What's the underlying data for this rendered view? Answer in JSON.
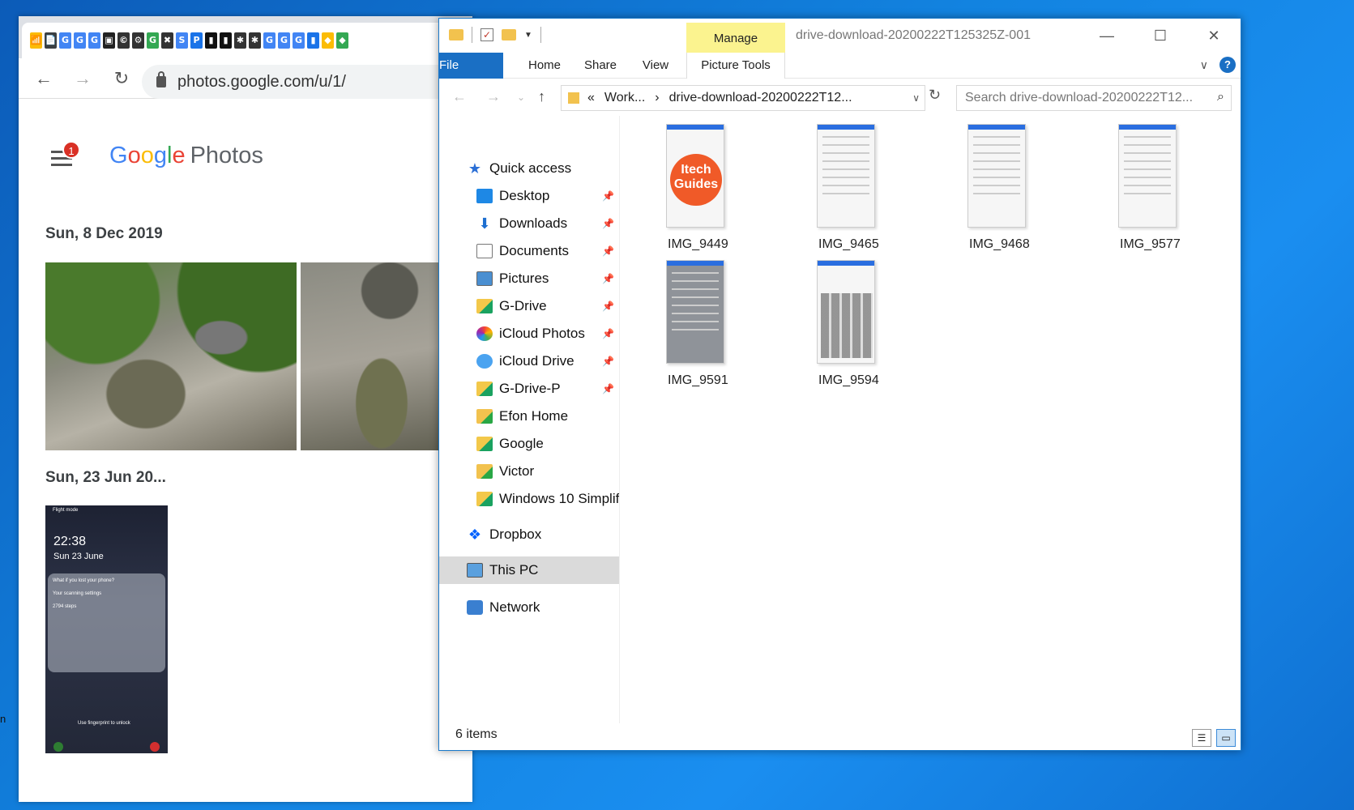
{
  "desktop": {
    "edge_text": "n"
  },
  "chrome": {
    "tab_favicons": [
      "📶",
      "📄",
      "G",
      "G",
      "G",
      "▣",
      "©",
      "⚙",
      "G",
      "✖",
      "S",
      "P",
      "▮",
      "▮",
      "✱",
      "✱",
      "G",
      "G",
      "G",
      "▮",
      "◆",
      "◆"
    ],
    "tab_close": "×",
    "nav": {
      "back": "←",
      "forward": "→",
      "reload": "↻"
    },
    "url": "photos.google.com/u/1/",
    "notification_count": "1",
    "logo": {
      "G": "G",
      "o1": "o",
      "o2": "o",
      "g": "g",
      "l": "l",
      "e": "e",
      "photos": "Photos"
    },
    "sections": [
      {
        "date": "Sun, 8 Dec 2019"
      },
      {
        "date": "Sun, 23 Jun 20..."
      }
    ],
    "phone_photo": {
      "flight": "Flight mode",
      "time": "22:38",
      "date": "Sun 23 June",
      "card_lines": [
        "What if you lost your phone?",
        "Your scanning settings",
        "2794 steps"
      ],
      "unlock": "Use fingerprint to unlock"
    }
  },
  "explorer": {
    "title": "drive-download-20200222T125325Z-001",
    "manage": "Manage",
    "window_controls": {
      "minimize": "—",
      "maximize": "☐",
      "close": "✕"
    },
    "ribbon_tabs": [
      "File",
      "Home",
      "Share",
      "View",
      "Picture Tools"
    ],
    "ribbon_collapse": "∨",
    "help": "?",
    "address": {
      "back": "←",
      "forward": "→",
      "recent": "⌄",
      "up": "↑",
      "prefix": "«",
      "crumbs": [
        "Work...",
        "›",
        "drive-download-20200222T12..."
      ],
      "dropdown": "∨",
      "refresh": "↻"
    },
    "search": {
      "placeholder": "Search drive-download-20200222T12...",
      "icon": "⌕"
    },
    "nav_items": [
      {
        "label": "Quick access",
        "pinned": false
      },
      {
        "label": "Desktop",
        "pinned": true
      },
      {
        "label": "Downloads",
        "pinned": true
      },
      {
        "label": "Documents",
        "pinned": true
      },
      {
        "label": "Pictures",
        "pinned": true
      },
      {
        "label": "G-Drive",
        "pinned": true
      },
      {
        "label": "iCloud Photos",
        "pinned": true
      },
      {
        "label": "iCloud Drive",
        "pinned": true
      },
      {
        "label": "G-Drive-P",
        "pinned": true
      },
      {
        "label": "Efon Home",
        "pinned": false
      },
      {
        "label": "Google",
        "pinned": false
      },
      {
        "label": "Victor",
        "pinned": false
      },
      {
        "label": "Windows 10 Simplif",
        "pinned": false
      },
      {
        "label": "Dropbox",
        "pinned": false
      },
      {
        "label": "This PC",
        "pinned": false,
        "selected": true
      },
      {
        "label": "Network",
        "pinned": false
      }
    ],
    "pin_glyph": "📌",
    "files": [
      {
        "name": "IMG_9449"
      },
      {
        "name": "IMG_9465"
      },
      {
        "name": "IMG_9468"
      },
      {
        "name": "IMG_9577"
      },
      {
        "name": "IMG_9591"
      },
      {
        "name": "IMG_9594"
      }
    ],
    "itech_thumb_text": [
      "Itech",
      "Guides"
    ],
    "status": {
      "count": "6 items"
    },
    "view_buttons": {
      "details": "☰",
      "large_icons": "▭"
    }
  }
}
